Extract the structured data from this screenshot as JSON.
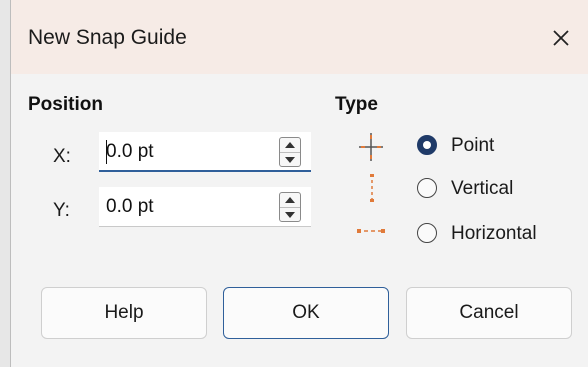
{
  "dialog": {
    "title": "New Snap Guide",
    "close_label": "✕"
  },
  "position": {
    "heading": "Position",
    "x_label": "X:",
    "x_value": "0.0 pt",
    "y_label": "Y:",
    "y_value": "0.0 pt"
  },
  "type": {
    "heading": "Type",
    "options": [
      {
        "label": "Point",
        "checked": true,
        "icon": "point-guide-icon"
      },
      {
        "label": "Vertical",
        "checked": false,
        "icon": "vertical-guide-icon"
      },
      {
        "label": "Horizontal",
        "checked": false,
        "icon": "horizontal-guide-icon"
      }
    ]
  },
  "buttons": {
    "help": "Help",
    "ok": "OK",
    "cancel": "Cancel"
  },
  "colors": {
    "accent": "#2f5f9a",
    "guide_orange": "#e07a3a"
  }
}
